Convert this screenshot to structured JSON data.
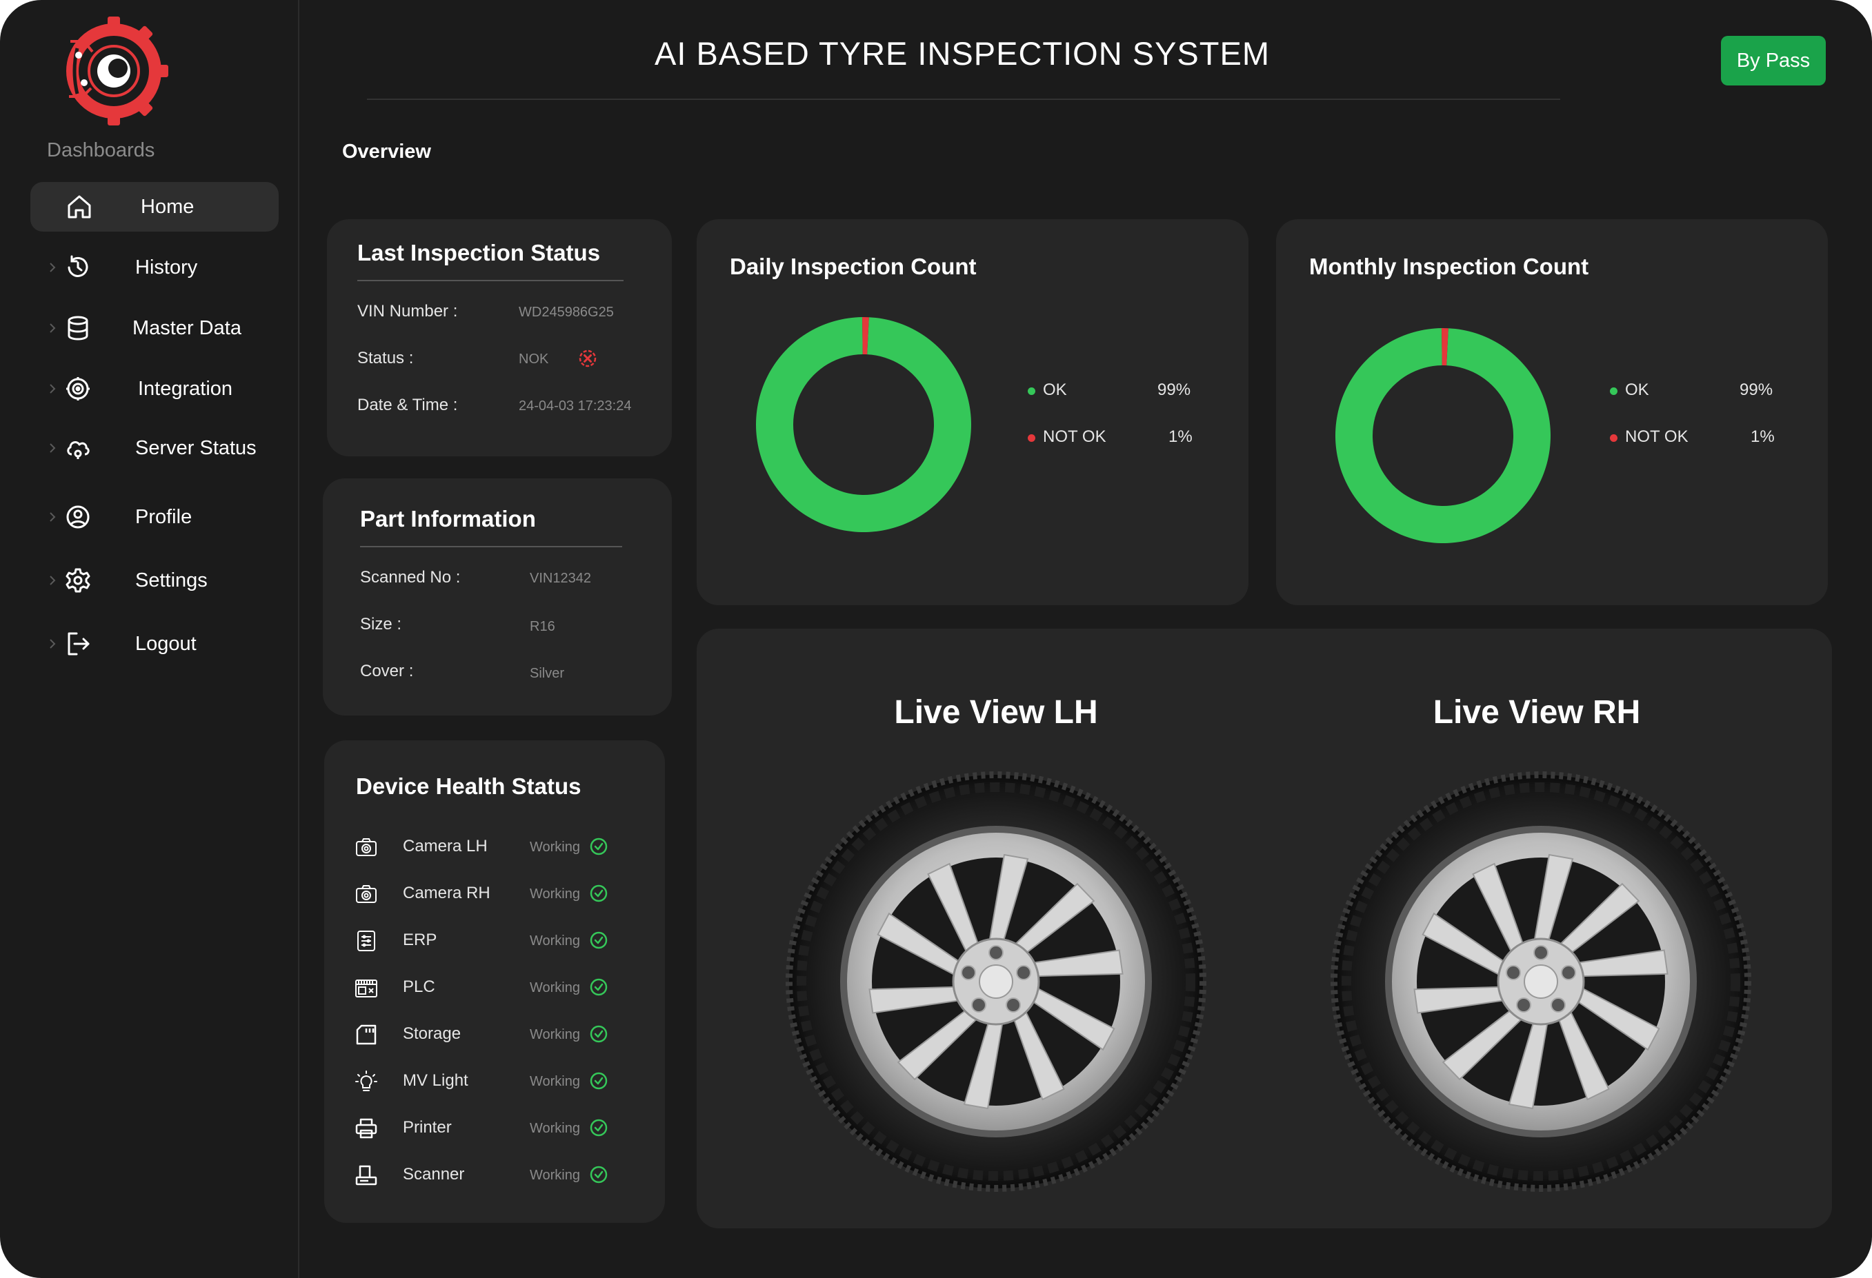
{
  "app": {
    "title": "AI BASED TYRE INSPECTION SYSTEM",
    "bypass_label": "By Pass",
    "section_label": "Overview"
  },
  "sidebar": {
    "section_label": "Dashboards",
    "items": [
      {
        "label": "Home",
        "icon": "home-icon"
      },
      {
        "label": "History",
        "icon": "history-icon"
      },
      {
        "label": "Master Data",
        "icon": "database-icon"
      },
      {
        "label": "Integration",
        "icon": "integration-icon"
      },
      {
        "label": "Server Status",
        "icon": "cloud-server-icon"
      },
      {
        "label": "Profile",
        "icon": "user-circle-icon"
      },
      {
        "label": "Settings",
        "icon": "gear-icon"
      },
      {
        "label": "Logout",
        "icon": "logout-icon"
      }
    ]
  },
  "last_inspection": {
    "title": "Last Inspection Status",
    "rows": [
      {
        "label": "VIN Number :",
        "value": "WD245986G25"
      },
      {
        "label": "Status :",
        "value": "NOK"
      },
      {
        "label": "Date & Time :",
        "value": "24-04-03 17:23:24"
      }
    ]
  },
  "part_info": {
    "title": "Part Information",
    "rows": [
      {
        "label": "Scanned No :",
        "value": "VIN12342"
      },
      {
        "label": "Size :",
        "value": "R16"
      },
      {
        "label": "Cover :",
        "value": "Silver"
      }
    ]
  },
  "device_health": {
    "title": "Device Health Status",
    "devices": [
      {
        "name": "Camera LH",
        "status": "Working",
        "icon": "camera-icon"
      },
      {
        "name": "Camera RH",
        "status": "Working",
        "icon": "camera-icon"
      },
      {
        "name": "ERP",
        "status": "Working",
        "icon": "erp-icon"
      },
      {
        "name": "PLC",
        "status": "Working",
        "icon": "plc-icon"
      },
      {
        "name": "Storage",
        "status": "Working",
        "icon": "storage-icon"
      },
      {
        "name": "MV Light",
        "status": "Working",
        "icon": "light-bulb-icon"
      },
      {
        "name": "Printer",
        "status": "Working",
        "icon": "printer-icon"
      },
      {
        "name": "Scanner",
        "status": "Working",
        "icon": "scanner-icon"
      }
    ]
  },
  "colors": {
    "ok": "#35c759",
    "not_ok": "#e5383b",
    "bypass": "#1aa34a",
    "card_bg": "#262626",
    "app_bg": "#1b1b1b"
  },
  "chart_data": [
    {
      "type": "pie",
      "variant": "donut",
      "title": "Daily Inspection Count",
      "categories": [
        "OK",
        "NOT OK"
      ],
      "values": [
        99,
        1
      ],
      "value_labels": [
        "99%",
        "1%"
      ],
      "colors": [
        "#35c759",
        "#e5383b"
      ],
      "legend": "right"
    },
    {
      "type": "pie",
      "variant": "donut",
      "title": "Monthly Inspection Count",
      "categories": [
        "OK",
        "NOT OK"
      ],
      "values": [
        99,
        1
      ],
      "value_labels": [
        "99%",
        "1%"
      ],
      "colors": [
        "#35c759",
        "#e5383b"
      ],
      "legend": "right"
    }
  ],
  "live_view": {
    "left_title": "Live View LH",
    "right_title": "Live View RH"
  }
}
